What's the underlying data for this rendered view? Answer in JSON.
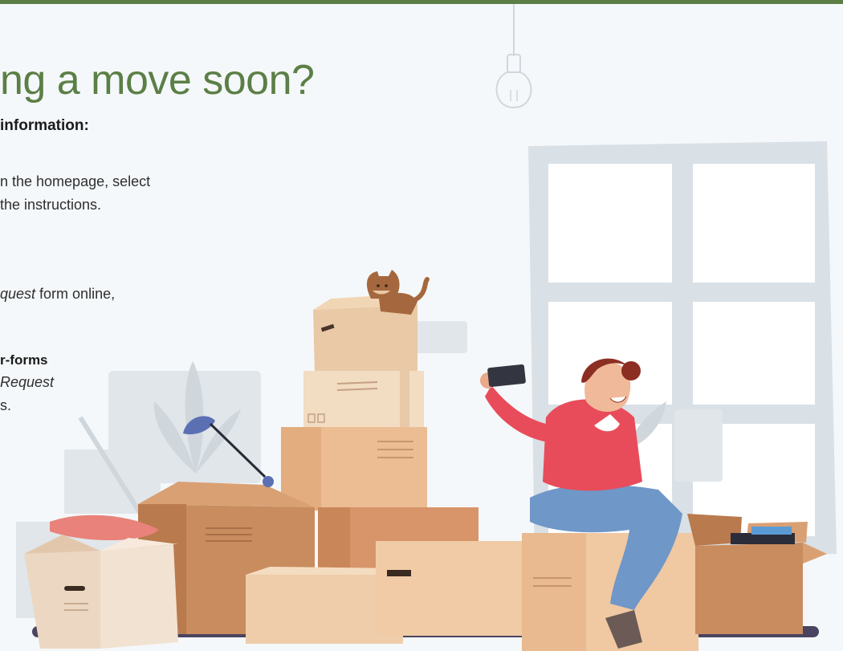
{
  "colors": {
    "accent": "#5b7f46",
    "headline": "#5b7f46",
    "text": "#2f2f2f"
  },
  "headline": "ng a move soon?",
  "subheading": "information:",
  "paragraph1": {
    "line1": "n the homepage, select",
    "line2": "the instructions."
  },
  "paragraph2": {
    "italic": "quest",
    "rest": " form online,"
  },
  "link_text": "r-forms",
  "paragraph3": {
    "line1_italic": "Request",
    "line2": "s."
  },
  "icons": [
    "lightbulb-icon",
    "cat-icon",
    "desk-lamp-icon",
    "plant-icon",
    "phone-icon"
  ]
}
